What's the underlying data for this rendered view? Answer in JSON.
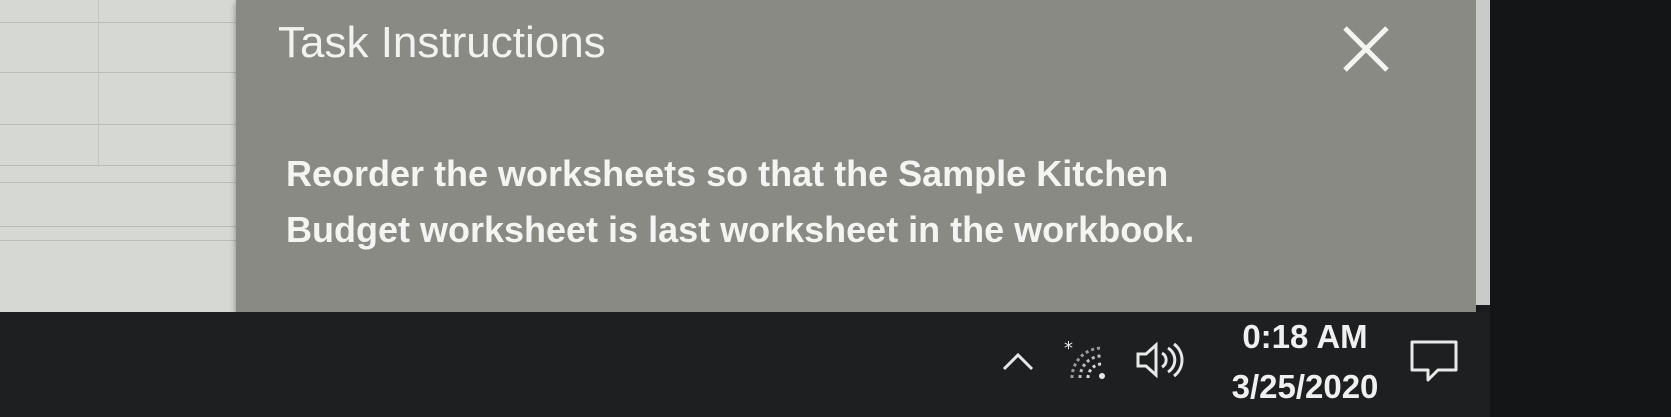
{
  "task_panel": {
    "title": "Task Instructions",
    "close_icon": "close-x-icon",
    "instruction_line1": "Reorder the worksheets so that the Sample Kitchen",
    "instruction_line2": "Budget worksheet is last worksheet in the workbook."
  },
  "taskbar": {
    "tray_icons": [
      "chevron-up-icon",
      "wifi-icon",
      "volume-icon"
    ],
    "time": "0:18 AM",
    "date": "3/25/2020",
    "action_center_icon": "notification-icon"
  },
  "colors": {
    "panel_bg": "#8a8a85",
    "taskbar_bg": "#1e1f21",
    "text": "#f4f4f2"
  }
}
